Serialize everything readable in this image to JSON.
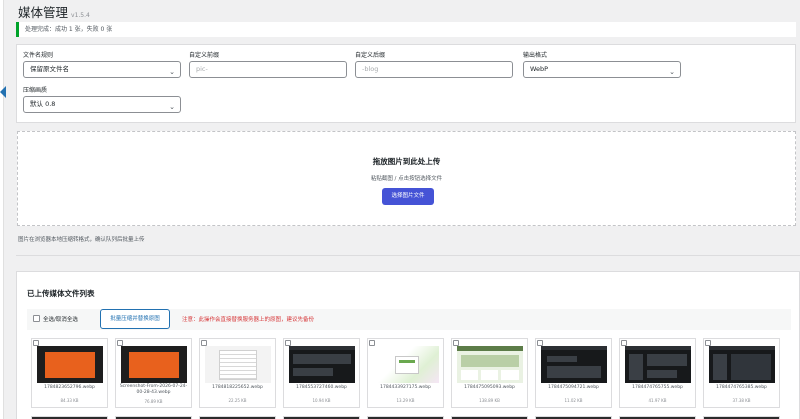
{
  "page": {
    "title": "媒体管理",
    "version": "v1.5.4",
    "notice": "处理完成：成功 1 张，失败 0 张"
  },
  "settings": {
    "filename_rule": {
      "label": "文件名规则",
      "value": "保留原文件名"
    },
    "prefix": {
      "label": "自定义前缀",
      "placeholder": "pic-"
    },
    "suffix": {
      "label": "自定义后缀",
      "placeholder": "-blog"
    },
    "format": {
      "label": "输出格式",
      "value": "WebP"
    },
    "quality": {
      "label": "压缩画质",
      "value": "默认 0.8"
    }
  },
  "upload": {
    "title": "拖放图片到此处上传",
    "subtitle": "粘贴截图 / 点击按钮选择文件",
    "button": "选择图片文件",
    "hint": "图片在浏览器本地压缩转格式，确认队列后批量上传"
  },
  "media": {
    "title": "已上传媒体文件列表",
    "select_all": "全选/取消全选",
    "batch_button": "批量压缩并替换原图",
    "warning": "注意：此操作会直接替换服务器上的原图，建议先备份",
    "items": [
      {
        "name": "1784823652796.webp",
        "size": "84.33 KB",
        "thumb": "orange"
      },
      {
        "name": "Screenshot-From-2026-07-24-00-28-43.webp",
        "size": "76.89 KB",
        "thumb": "orange"
      },
      {
        "name": "1784818225652.webp",
        "size": "22.25 KB",
        "thumb": "light"
      },
      {
        "name": "1784553727460.webp",
        "size": "10.94 KB",
        "thumb": "dark"
      },
      {
        "name": "1784433927175.webp",
        "size": "13.29 KB",
        "thumb": "light"
      },
      {
        "name": "1784475095093.webp",
        "size": "138.89 KB",
        "thumb": "web"
      },
      {
        "name": "1784475094721.webp",
        "size": "11.02 KB",
        "thumb": "dark"
      },
      {
        "name": "1784474765755.webp",
        "size": "41.97 KB",
        "thumb": "dark"
      },
      {
        "name": "1784474765385.webp",
        "size": "37.38 KB",
        "thumb": "dark"
      }
    ]
  },
  "colors": {
    "accent": "#2271b1",
    "primary_button": "#4553d6",
    "success_border": "#00a32a",
    "warning_text": "#d63638"
  }
}
